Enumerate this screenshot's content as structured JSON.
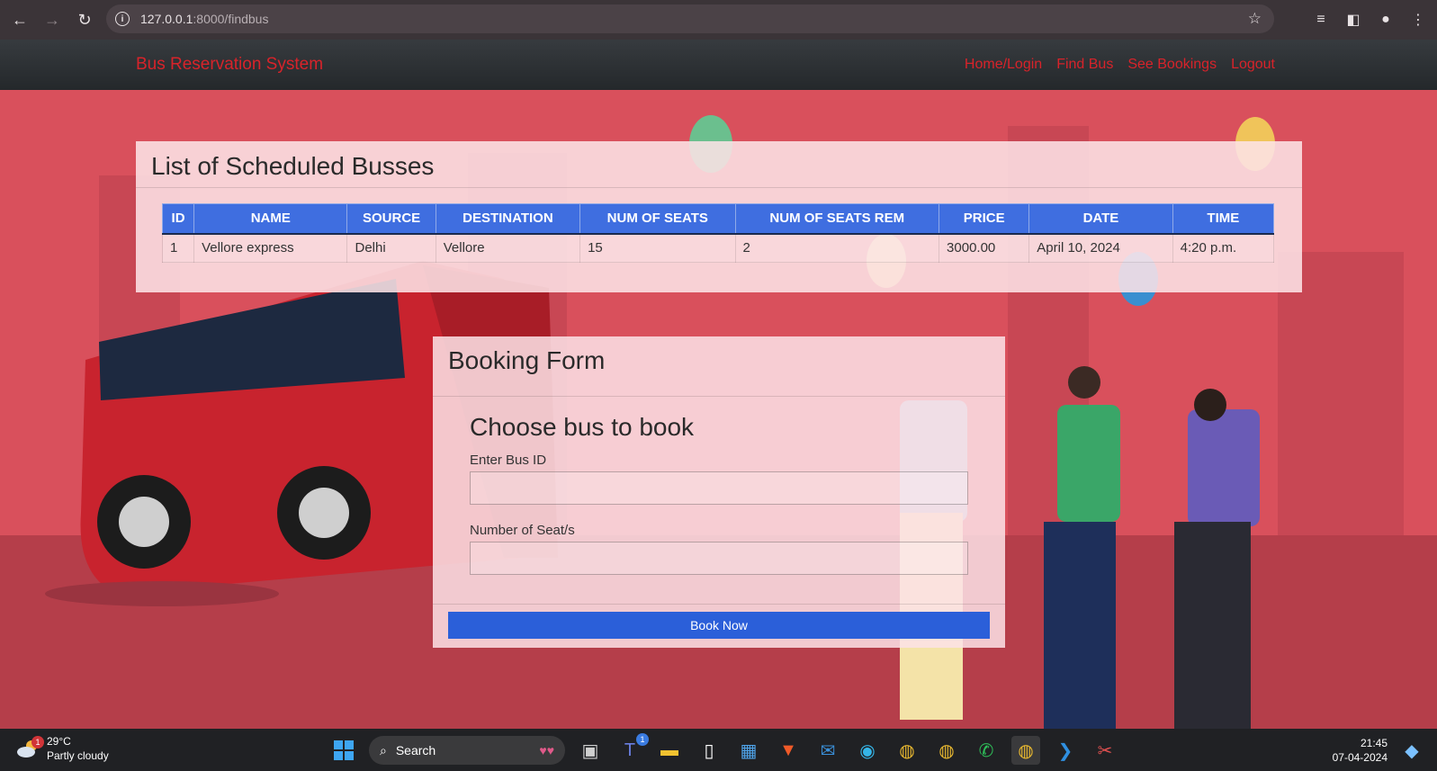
{
  "browser": {
    "url_host": "127.0.0.1",
    "url_path": ":8000/findbus"
  },
  "navbar": {
    "brand": "Bus Reservation System",
    "links": [
      "Home/Login",
      "Find Bus",
      "See Bookings",
      "Logout"
    ]
  },
  "bus_list": {
    "title": "List of Scheduled Busses",
    "columns": [
      "ID",
      "NAME",
      "SOURCE",
      "DESTINATION",
      "NUM OF SEATS",
      "NUM OF SEATS REM",
      "PRICE",
      "DATE",
      "TIME"
    ],
    "rows": [
      [
        "1",
        "Vellore express",
        "Delhi",
        "Vellore",
        "15",
        "2",
        "3000.00",
        "April 10, 2024",
        "4:20 p.m."
      ]
    ]
  },
  "booking_form": {
    "title": "Booking Form",
    "subtitle": "Choose bus to book",
    "bus_id_label": "Enter Bus ID",
    "bus_id_value": "",
    "seats_label": "Number of Seat/s",
    "seats_value": "",
    "submit_label": "Book Now"
  },
  "taskbar": {
    "weather_temp": "29°C",
    "weather_desc": "Partly cloudy",
    "weather_badge": "1",
    "search_label": "Search",
    "teams_badge": "1",
    "time": "21:45",
    "date": "07-04-2024"
  },
  "colors": {
    "accent_blue": "#2b5fd9",
    "brand_red": "#d8232a",
    "table_header": "#3f6ee0"
  }
}
